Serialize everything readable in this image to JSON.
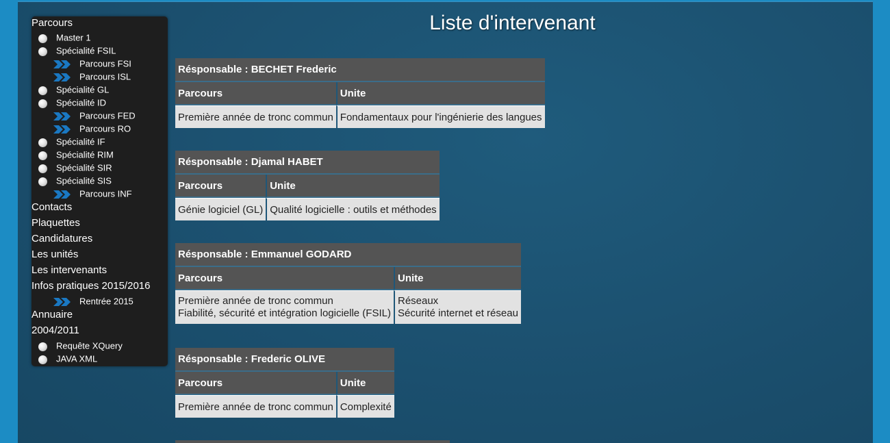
{
  "page_title": "Liste d'intervenant",
  "sidebar": {
    "parcours": "Parcours",
    "master1": "Master 1",
    "spec_fsil": "Spécialité FSIL",
    "parcours_fsi": "Parcours FSI",
    "parcours_isl": "Parcours ISL",
    "spec_gl": "Spécialité GL",
    "spec_id": "Spécialité ID",
    "parcours_fed": "Parcours FED",
    "parcours_ro": "Parcours RO",
    "spec_if": "Spécialité IF",
    "spec_rim": "Spécialité RIM",
    "spec_sir": "Spécialité SIR",
    "spec_sis": "Spécialité SIS",
    "parcours_inf": "Parcours INF",
    "contacts": "Contacts",
    "plaquettes": "Plaquettes",
    "candidatures": "Candidatures",
    "unites": "Les unités",
    "intervenants": "Les intervenants",
    "infos": "Infos pratiques 2015/2016",
    "rentree": "Rentrée 2015",
    "annuaire": "Annuaire",
    "archive": "2004/2011",
    "xquery": "Requête XQuery",
    "javaxml": "JAVA XML"
  },
  "col_parcours": "Parcours",
  "col_unite": "Unite",
  "responsables": [
    {
      "title": "Résponsable : BECHET Frederic",
      "parcours": "Première année de tronc commun",
      "unite": "Fondamentaux pour l'ingénierie des langues"
    },
    {
      "title": "Résponsable : Djamal HABET",
      "parcours": "Génie logiciel (GL)",
      "unite": "Qualité logicielle : outils et méthodes"
    },
    {
      "title": "Résponsable : Emmanuel GODARD",
      "parcours_1": "Première année de tronc commun",
      "parcours_2": "Fiabilité, sécurité et intégration logicielle (FSIL)",
      "unite_1": "Réseaux",
      "unite_2": "Sécurité internet et réseau"
    },
    {
      "title": "Résponsable : Frederic OLIVE",
      "parcours": "Première année de tronc commun",
      "unite": "Complexité"
    }
  ],
  "colors": {
    "background": "#1c8cc4",
    "header": "#545454",
    "cell": "#e2e2e2",
    "sidebar": "#1e1e1e"
  }
}
